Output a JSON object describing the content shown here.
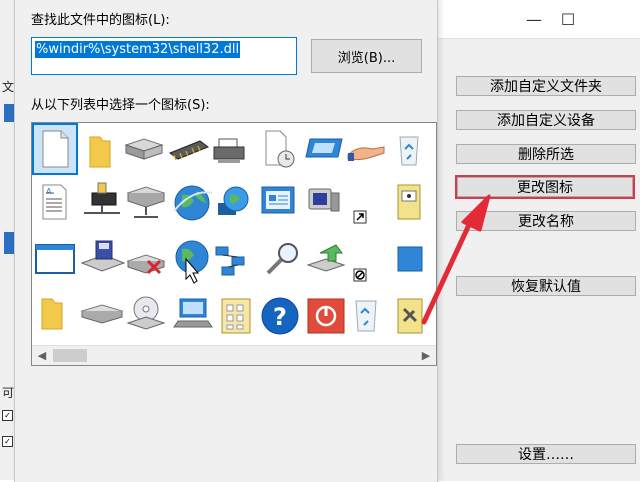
{
  "dialog": {
    "find_label": "查找此文件中的图标(L):",
    "path_value": "%windir%\\system32\\shell32.dll",
    "browse_label": "浏览(B)...",
    "select_label": "从以下列表中选择一个图标(S):",
    "icons": [
      [
        "blank-file-icon",
        "folder-icon",
        "hard-drive-icon",
        "memory-chip-icon",
        "printer-icon",
        "clock-file-icon",
        "network-monitor-icon",
        "hand-share-icon",
        "recycle-bin-icon"
      ],
      [
        "text-document-icon",
        "network-drive-icon",
        "network-server-icon",
        "globe-icon",
        "globe-monitor-icon",
        "control-panel-icon",
        "monitor-icon",
        "shortcut-arrow-icon",
        "file-cabinet-icon"
      ],
      [
        "application-window-icon",
        "floppy-drive-icon",
        "disconnected-drive-icon",
        "globe-cursor-icon",
        "network-icon",
        "search-icon",
        "green-arrow-drive-icon",
        "no-entry-icon",
        "blue-square-icon"
      ],
      [
        "yellow-folder-icon",
        "flat-drive-icon",
        "cd-drive-icon",
        "laptop-monitor-icon",
        "calculator-icon",
        "help-icon",
        "power-icon",
        "recycle-bin-empty-icon",
        "tool-cabinet-icon"
      ]
    ]
  },
  "main": {
    "window_controls": {
      "minimize": "—",
      "maximize": "☐"
    },
    "buttons": [
      {
        "label": "添加自定义文件夹"
      },
      {
        "label": "添加自定义设备"
      },
      {
        "label": "删除所选"
      },
      {
        "label": "更改图标"
      },
      {
        "label": "更改名称"
      },
      {
        "label": "恢复默认值"
      },
      {
        "label": "设置……"
      }
    ],
    "left_strip": {
      "char1": "文",
      "char2": "可"
    }
  },
  "colors": {
    "accent": "#0078d7",
    "highlight": "#d33a4b"
  }
}
